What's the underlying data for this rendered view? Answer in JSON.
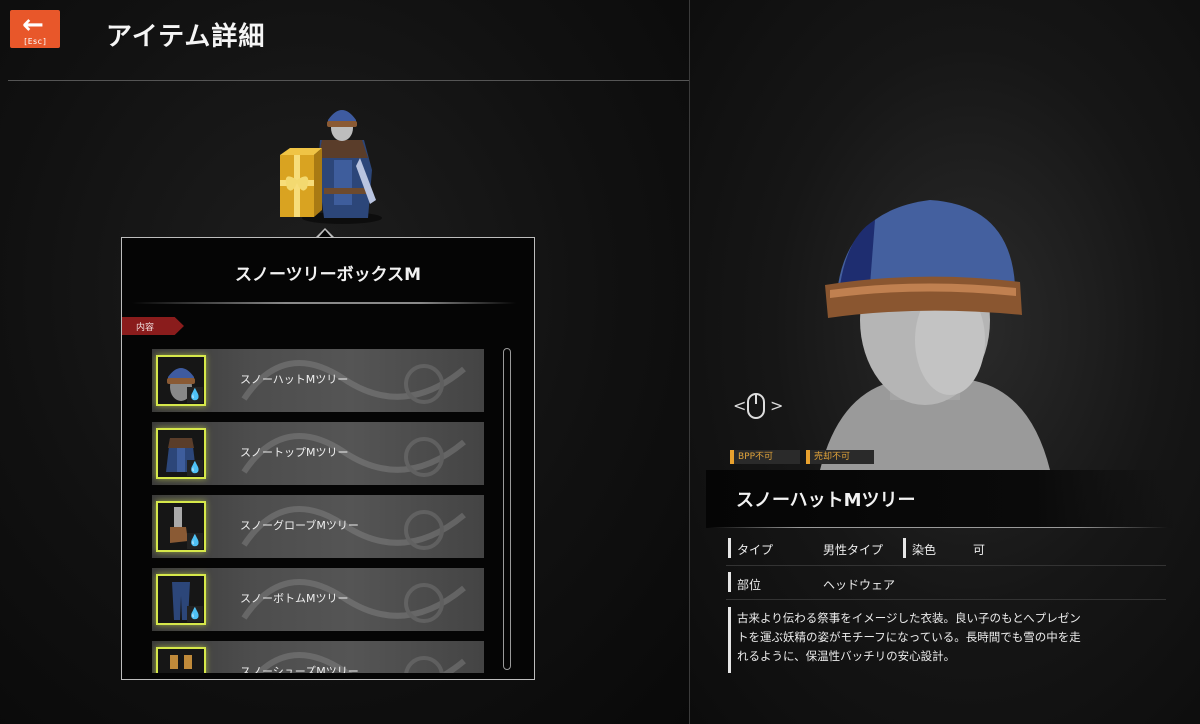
{
  "header": {
    "back_key": "[Esc]",
    "title": "アイテム詳細"
  },
  "card": {
    "title": "スノーツリーボックスM",
    "contents_label": "内容",
    "items": [
      {
        "name": "スノーハットMツリー"
      },
      {
        "name": "スノートップMツリー"
      },
      {
        "name": "スノーグローブMツリー"
      },
      {
        "name": "スノーボトムMツリー"
      },
      {
        "name": "スノーシューズMツリー"
      }
    ]
  },
  "detail": {
    "tags": [
      "BPP不可",
      "売却不可"
    ],
    "name": "スノーハットMツリー",
    "type_label": "タイプ",
    "type_value": "男性タイプ",
    "dye_label": "染色",
    "dye_value": "可",
    "slot_label": "部位",
    "slot_value": "ヘッドウェア",
    "description_lines": [
      "古来より伝わる祭事をイメージした衣装。良い子のもとへプレゼン",
      "トを運ぶ妖精の姿がモチーフになっている。長時間でも雪の中を走",
      "れるように、保温性バッチリの安心設計。"
    ]
  },
  "colors": {
    "accent_orange": "#e8572a",
    "tag_orange": "#e0a33a",
    "rarity_glow": "#d6e84a",
    "contents_tag": "#8a1c1c"
  }
}
